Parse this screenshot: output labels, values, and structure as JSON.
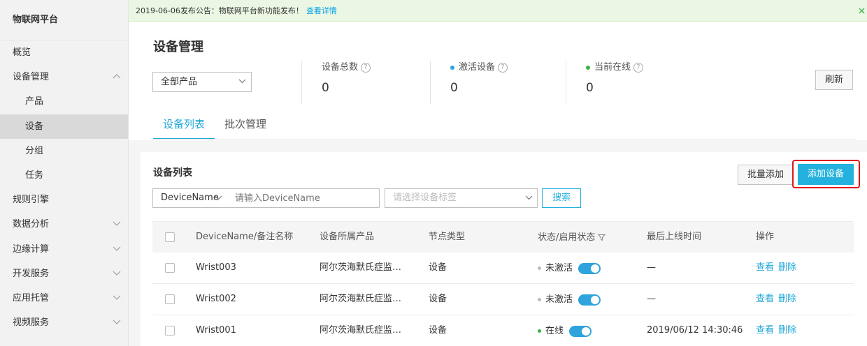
{
  "sidebar": {
    "brand": "物联网平台",
    "items": [
      {
        "label": "概览",
        "sub": false,
        "active": false,
        "expand": ""
      },
      {
        "label": "设备管理",
        "sub": false,
        "active": false,
        "expand": "up"
      },
      {
        "label": "产品",
        "sub": true,
        "active": false,
        "expand": ""
      },
      {
        "label": "设备",
        "sub": true,
        "active": true,
        "expand": ""
      },
      {
        "label": "分组",
        "sub": true,
        "active": false,
        "expand": ""
      },
      {
        "label": "任务",
        "sub": true,
        "active": false,
        "expand": ""
      },
      {
        "label": "规则引擎",
        "sub": false,
        "active": false,
        "expand": ""
      },
      {
        "label": "数据分析",
        "sub": false,
        "active": false,
        "expand": "down"
      },
      {
        "label": "边缘计算",
        "sub": false,
        "active": false,
        "expand": "down"
      },
      {
        "label": "开发服务",
        "sub": false,
        "active": false,
        "expand": "down"
      },
      {
        "label": "应用托管",
        "sub": false,
        "active": false,
        "expand": "down"
      },
      {
        "label": "视频服务",
        "sub": false,
        "active": false,
        "expand": "down"
      }
    ]
  },
  "notice": {
    "text": "2019-06-06发布公告：物联网平台新功能发布！",
    "link": "查看详情"
  },
  "header": {
    "title": "设备管理",
    "product_select": "全部产品",
    "stats": [
      {
        "label": "设备总数",
        "value": "0",
        "dot_color": ""
      },
      {
        "label": "激活设备",
        "value": "0",
        "dot_color": "#2ea3dc"
      },
      {
        "label": "当前在线",
        "value": "0",
        "dot_color": "#3bb346"
      }
    ],
    "refresh_label": "刷新",
    "tabs": [
      "设备列表",
      "批次管理"
    ]
  },
  "list": {
    "title": "设备列表",
    "batch_add_label": "批量添加",
    "add_label": "添加设备",
    "filter_field": "DeviceName",
    "name_placeholder": "请输入DeviceName",
    "tag_placeholder": "请选择设备标签",
    "search_label": "搜索",
    "columns": [
      "DeviceName/备注名称",
      "设备所属产品",
      "节点类型",
      "状态/启用状态",
      "最后上线时间",
      "操作"
    ],
    "rows": [
      {
        "name": "Wrist003",
        "product": "阿尔茨海默氏症监…",
        "node": "设备",
        "status": "未激活",
        "status_color": "#bbbbbb",
        "last_online": "—",
        "op_view": "查看",
        "op_delete": "删除"
      },
      {
        "name": "Wrist002",
        "product": "阿尔茨海默氏症监…",
        "node": "设备",
        "status": "未激活",
        "status_color": "#bbbbbb",
        "last_online": "—",
        "op_view": "查看",
        "op_delete": "删除"
      },
      {
        "name": "Wrist001",
        "product": "阿尔茨海默氏症监…",
        "node": "设备",
        "status": "在线",
        "status_color": "#3bb346",
        "last_online": "2019/06/12 14:30:46",
        "op_view": "查看",
        "op_delete": "删除"
      }
    ]
  }
}
